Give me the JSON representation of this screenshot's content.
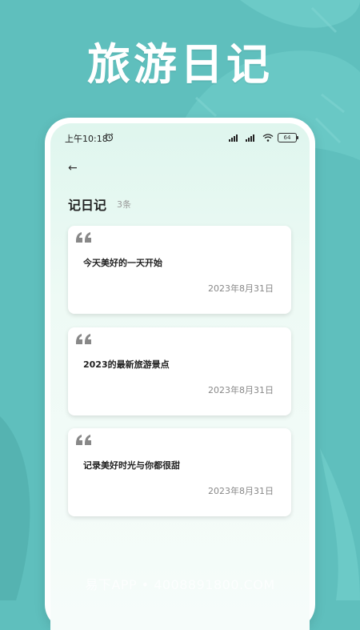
{
  "banner": {
    "title": "旅游日记"
  },
  "status_bar": {
    "time": "上午10:18",
    "battery": "64",
    "icons": [
      "alarm-icon",
      "signal-icon",
      "signal-icon",
      "wifi-icon",
      "battery-icon"
    ]
  },
  "page": {
    "back_icon": "←",
    "title": "记日记",
    "count": "3条"
  },
  "entries": [
    {
      "text": "今天美好的一天开始",
      "date": "2023年8月31日"
    },
    {
      "text": "2023的最新旅游景点",
      "date": "2023年8月31日"
    },
    {
      "text": "记录美好时光与你都很甜",
      "date": "2023年8月31日"
    }
  ],
  "watermark": "易下APP • 4008891800.COM",
  "colors": {
    "background": "#5fbfbd",
    "screen": "#dff6ee",
    "card": "#ffffff",
    "quote": "#888888"
  }
}
